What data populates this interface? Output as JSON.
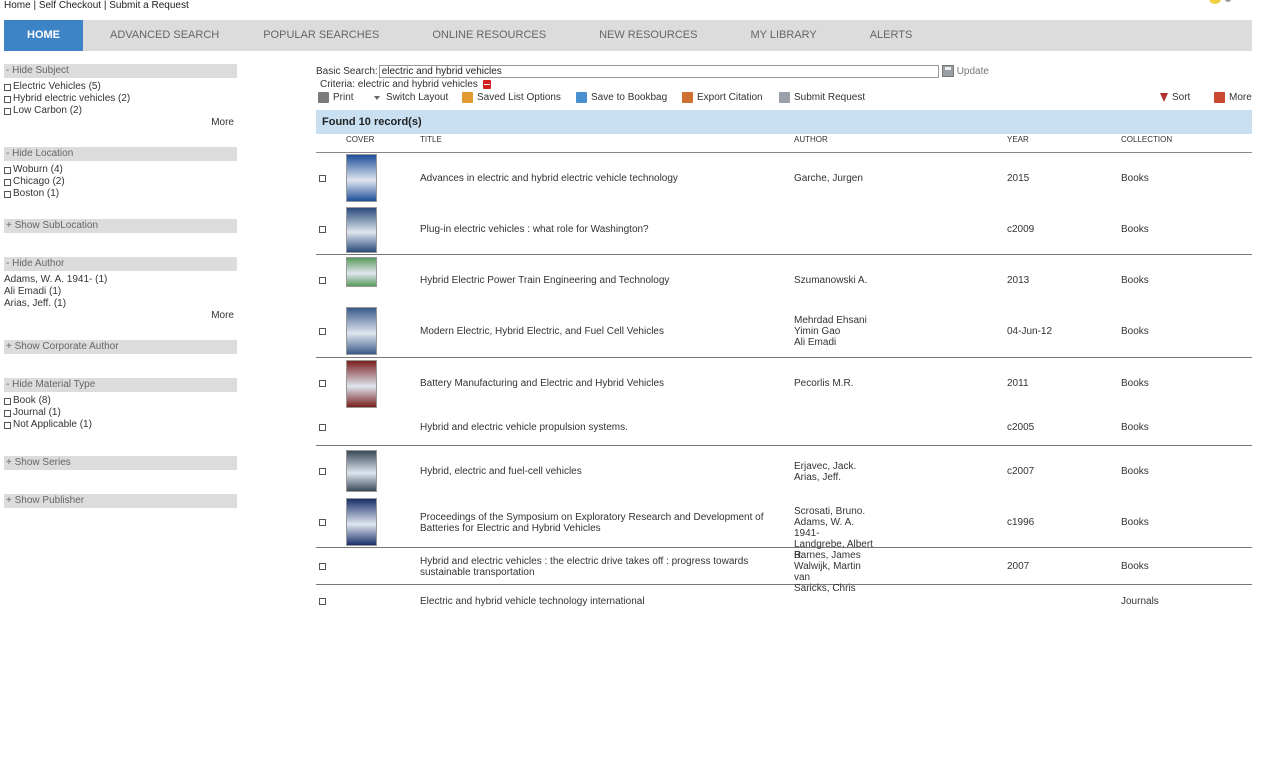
{
  "top_links": "Home | Self Checkout | Submit a Request",
  "nav": {
    "items": [
      {
        "label": "HOME",
        "active": true
      },
      {
        "label": "ADVANCED SEARCH"
      },
      {
        "label": "POPULAR SEARCHES"
      },
      {
        "label": "ONLINE RESOURCES"
      },
      {
        "label": "NEW RESOURCES"
      },
      {
        "label": "MY LIBRARY"
      },
      {
        "label": "ALERTS"
      }
    ]
  },
  "sidebar": {
    "subject": {
      "header": "- Hide Subject",
      "options": [
        "Electric Vehicles (5)",
        "Hybrid electric vehicles (2)",
        "Low Carbon (2)"
      ],
      "more": "More"
    },
    "location": {
      "header": "- Hide Location",
      "options": [
        "Woburn (4)",
        "Chicago (2)",
        "Boston (1)"
      ]
    },
    "sublocation": {
      "header": "+ Show SubLocation"
    },
    "author": {
      "header": "- Hide Author",
      "options": [
        "Adams, W. A. 1941- (1)",
        "Ali Emadi (1)",
        "Arias, Jeff. (1)"
      ],
      "more": "More"
    },
    "corporate_author": {
      "header": "+ Show Corporate Author"
    },
    "material_type": {
      "header": "- Hide Material Type",
      "options": [
        "Book (8)",
        "Journal (1)",
        "Not Applicable (1)"
      ]
    },
    "series": {
      "header": "+ Show Series"
    },
    "publisher": {
      "header": "+ Show Publisher"
    }
  },
  "search": {
    "label": "Basic Search:",
    "value": "electric and hybrid vehicles",
    "update_label": "Update"
  },
  "criteria": {
    "text": "Criteria: electric and hybrid vehicles"
  },
  "toolbar": {
    "print": "Print",
    "switch_layout": "Switch Layout",
    "saved_list_options": "Saved List Options",
    "save_to_bookbag": "Save to Bookbag",
    "export_citation": "Export Citation",
    "submit_request": "Submit Request",
    "sort": "Sort",
    "more": "More"
  },
  "results": {
    "found": "Found 10 record(s)",
    "columns": {
      "cover": "COVER",
      "title": "TITLE",
      "author": "AUTHOR",
      "year": "YEAR",
      "collection": "COLLECTION"
    },
    "rows": [
      {
        "title": "Advances in electric and hybrid electric vehicle technology",
        "author": "Garche, Jurgen",
        "year": "2015",
        "collection": "Books",
        "cover_color": "#1f4f9a"
      },
      {
        "title": "Plug-in electric vehicles : what role for Washington?",
        "author": "",
        "year": "c2009",
        "collection": "Books",
        "cover_color": "#2a4a7a"
      },
      {
        "title": "Hybrid Electric Power Train Engineering and Technology",
        "author": "Szumanowski A.",
        "year": "2013",
        "collection": "Books",
        "cover_color": "#5a9a5a"
      },
      {
        "title": "Modern Electric, Hybrid Electric, and Fuel Cell Vehicles",
        "author": "Mehrdad Ehsani\nYimin Gao\nAli Emadi",
        "year": "04-Jun-12",
        "collection": "Books",
        "cover_color": "#3a5a8a"
      },
      {
        "title": "Battery Manufacturing and Electric and Hybrid Vehicles",
        "author": "Pecorlis M.R.",
        "year": "2011",
        "collection": "Books",
        "cover_color": "#7a1f1f"
      },
      {
        "title": "Hybrid and electric vehicle propulsion systems.",
        "author": "",
        "year": "c2005",
        "collection": "Books",
        "cover_color": ""
      },
      {
        "title": "Hybrid, electric and fuel-cell vehicles",
        "author": "Erjavec, Jack.\nArias, Jeff.",
        "year": "c2007",
        "collection": "Books",
        "cover_color": "#3a4a5a"
      },
      {
        "title": "Proceedings of the Symposium on Exploratory Research and Development of Batteries for Electric and Hybrid Vehicles",
        "author": "Scrosati, Bruno.\nAdams, W. A. 1941-\nLandgrebe, Albert R.",
        "year": "c1996",
        "collection": "Books",
        "cover_color": "#1a2f6a"
      },
      {
        "title": "Hybrid and electric vehicles : the electric drive takes off : progress towards sustainable transportation",
        "author": "Barnes, James\nWalwijk, Martin van\nSaricks, Chris",
        "year": "2007",
        "collection": "Books",
        "cover_color": ""
      },
      {
        "title": "Electric and hybrid vehicle technology international",
        "author": "",
        "year": "",
        "collection": "Journals",
        "cover_color": ""
      }
    ]
  }
}
